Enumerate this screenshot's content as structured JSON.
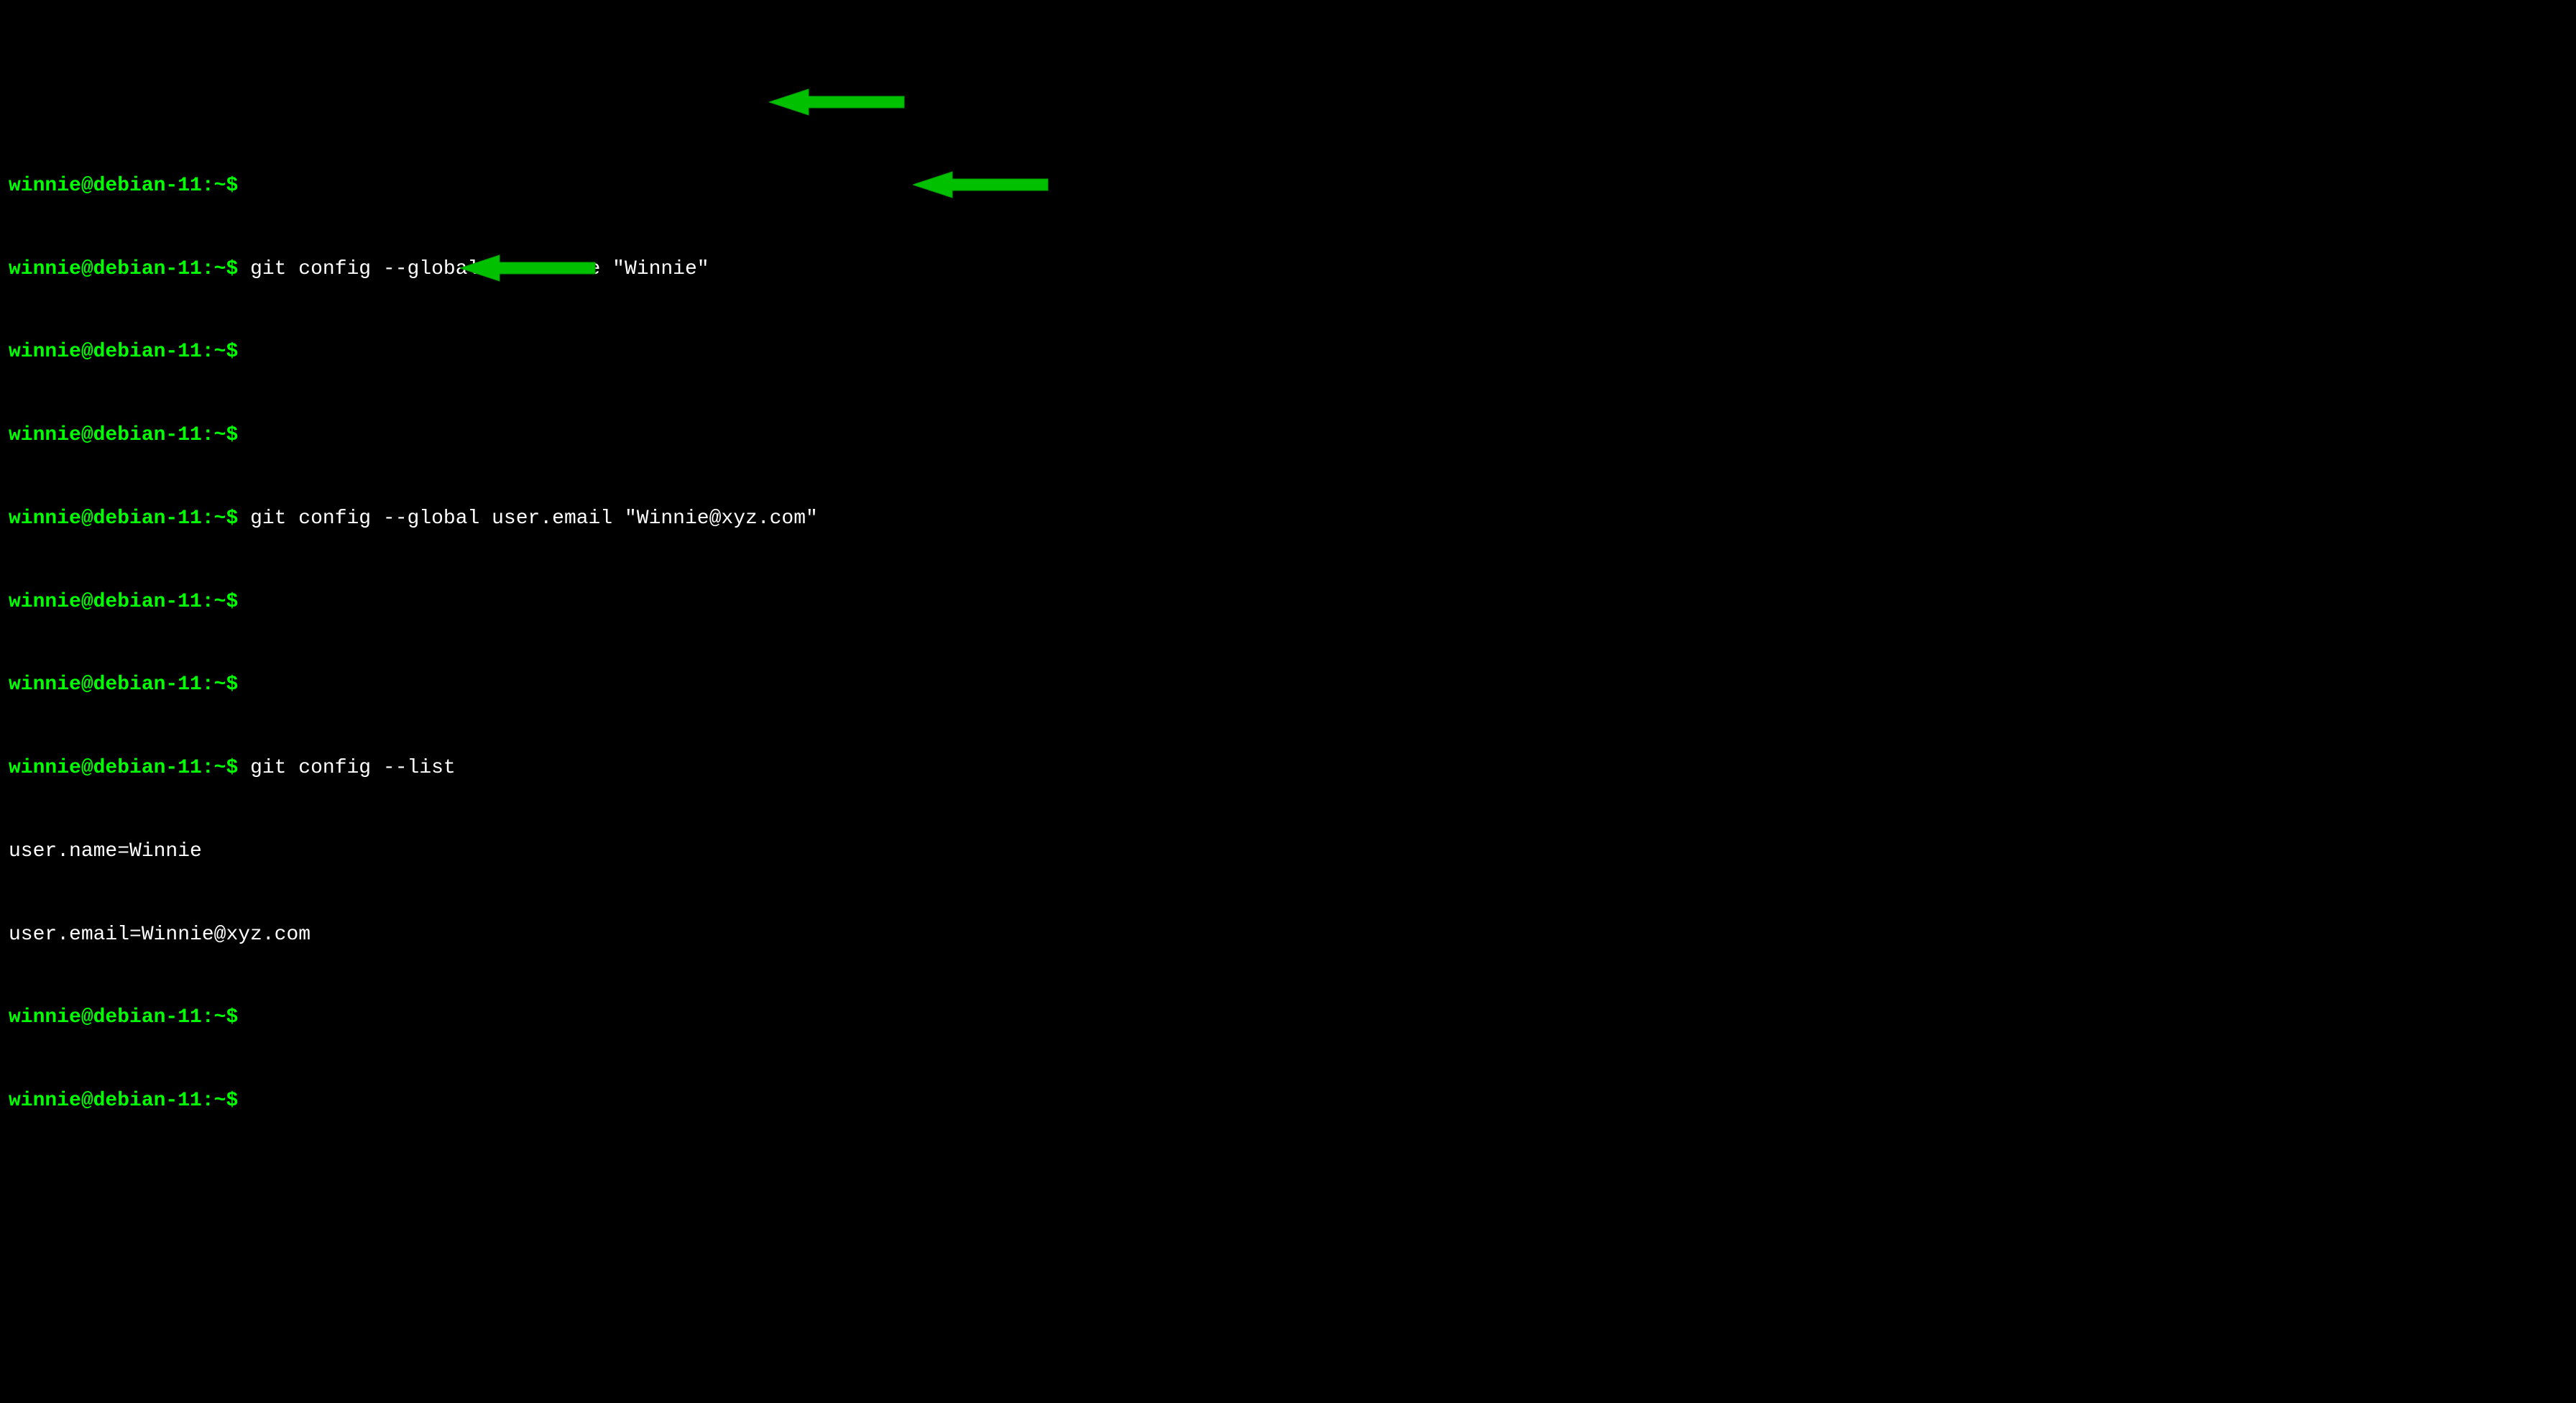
{
  "terminal": {
    "prompt": "winnie@debian-11:~$",
    "lines": [
      {
        "type": "prompt",
        "command": ""
      },
      {
        "type": "prompt",
        "command": "git config --global user.name \"Winnie\""
      },
      {
        "type": "prompt",
        "command": ""
      },
      {
        "type": "prompt",
        "command": ""
      },
      {
        "type": "prompt",
        "command": "git config --global user.email \"Winnie@xyz.com\""
      },
      {
        "type": "prompt",
        "command": ""
      },
      {
        "type": "prompt",
        "command": ""
      },
      {
        "type": "prompt",
        "command": "git config --list"
      },
      {
        "type": "output",
        "text": "user.name=Winnie"
      },
      {
        "type": "output",
        "text": "user.email=Winnie@xyz.com"
      },
      {
        "type": "prompt",
        "command": ""
      },
      {
        "type": "prompt",
        "command": ""
      }
    ]
  },
  "annotations": {
    "arrows": [
      {
        "target": "git config --global user.name"
      },
      {
        "target": "git config --global user.email"
      },
      {
        "target": "git config --list"
      }
    ]
  }
}
